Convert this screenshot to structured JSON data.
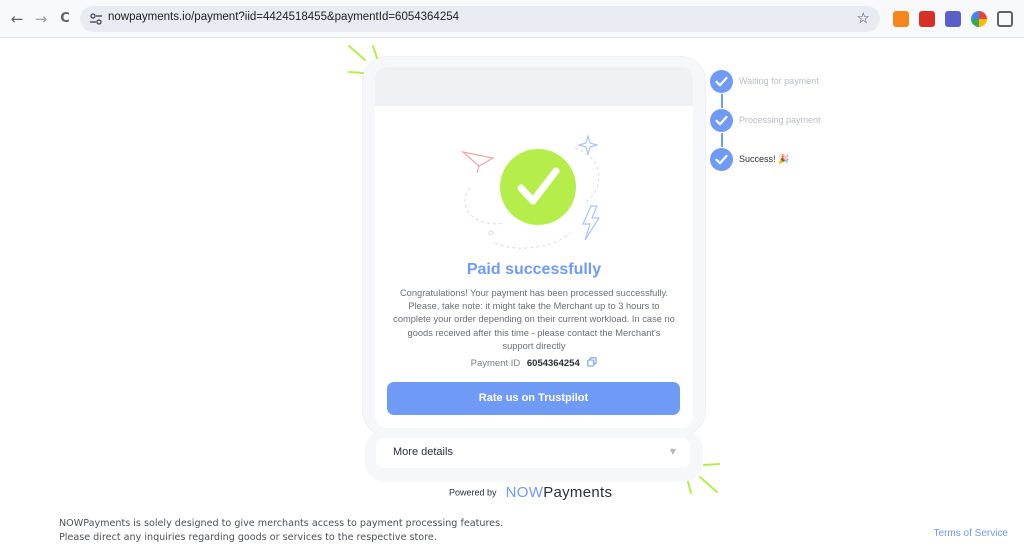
{
  "browser": {
    "url": "nowpayments.io/payment?iid=4424518455&paymentId=6054364254",
    "back_glyph": "←",
    "forward_glyph": "→",
    "reload_glyph": "C",
    "star_glyph": "☆",
    "extensions": [
      {
        "name": "metamask-icon",
        "color": "#f6851b"
      },
      {
        "name": "red-extension-icon",
        "color": "#d93025"
      },
      {
        "name": "purple-extension-icon",
        "color": "#5b5fc7"
      },
      {
        "name": "color-wheel-icon",
        "color": "#34a853"
      },
      {
        "name": "puzzle-icon",
        "color": "#5f6368"
      }
    ]
  },
  "payment": {
    "title": "Paid successfully",
    "message": "Congratulations! Your payment has been processed successfully. Please, take note: it might take the Merchant up to 3 hours to complete your order depending on their current workload. In case no goods received after this time - please contact the Merchant's support directly",
    "payment_id_label": "Payment ID",
    "payment_id_value": "6054364254",
    "rate_button": "Rate us on Trustpilot",
    "more_details": "More details"
  },
  "steps": [
    {
      "label": "Waiting for payment",
      "state": "done",
      "color": "#b9bdc4"
    },
    {
      "label": "Processing payment",
      "state": "done",
      "color": "#b9bdc4"
    },
    {
      "label": "Success! 🎉",
      "state": "current",
      "color": "#2b2f36"
    }
  ],
  "powered": {
    "by": "Powered by",
    "brand_now": "NOW",
    "brand_payments": "Payments"
  },
  "footer": {
    "line1": "NOWPayments is solely designed to give merchants access to payment processing features.",
    "line2": "Please direct any inquiries regarding goods or services to the respective store.",
    "terms": "Terms of Service"
  },
  "colors": {
    "accent": "#6f9af6",
    "success_green": "#b5ee4a",
    "deco_green": "#b5ee4a"
  }
}
